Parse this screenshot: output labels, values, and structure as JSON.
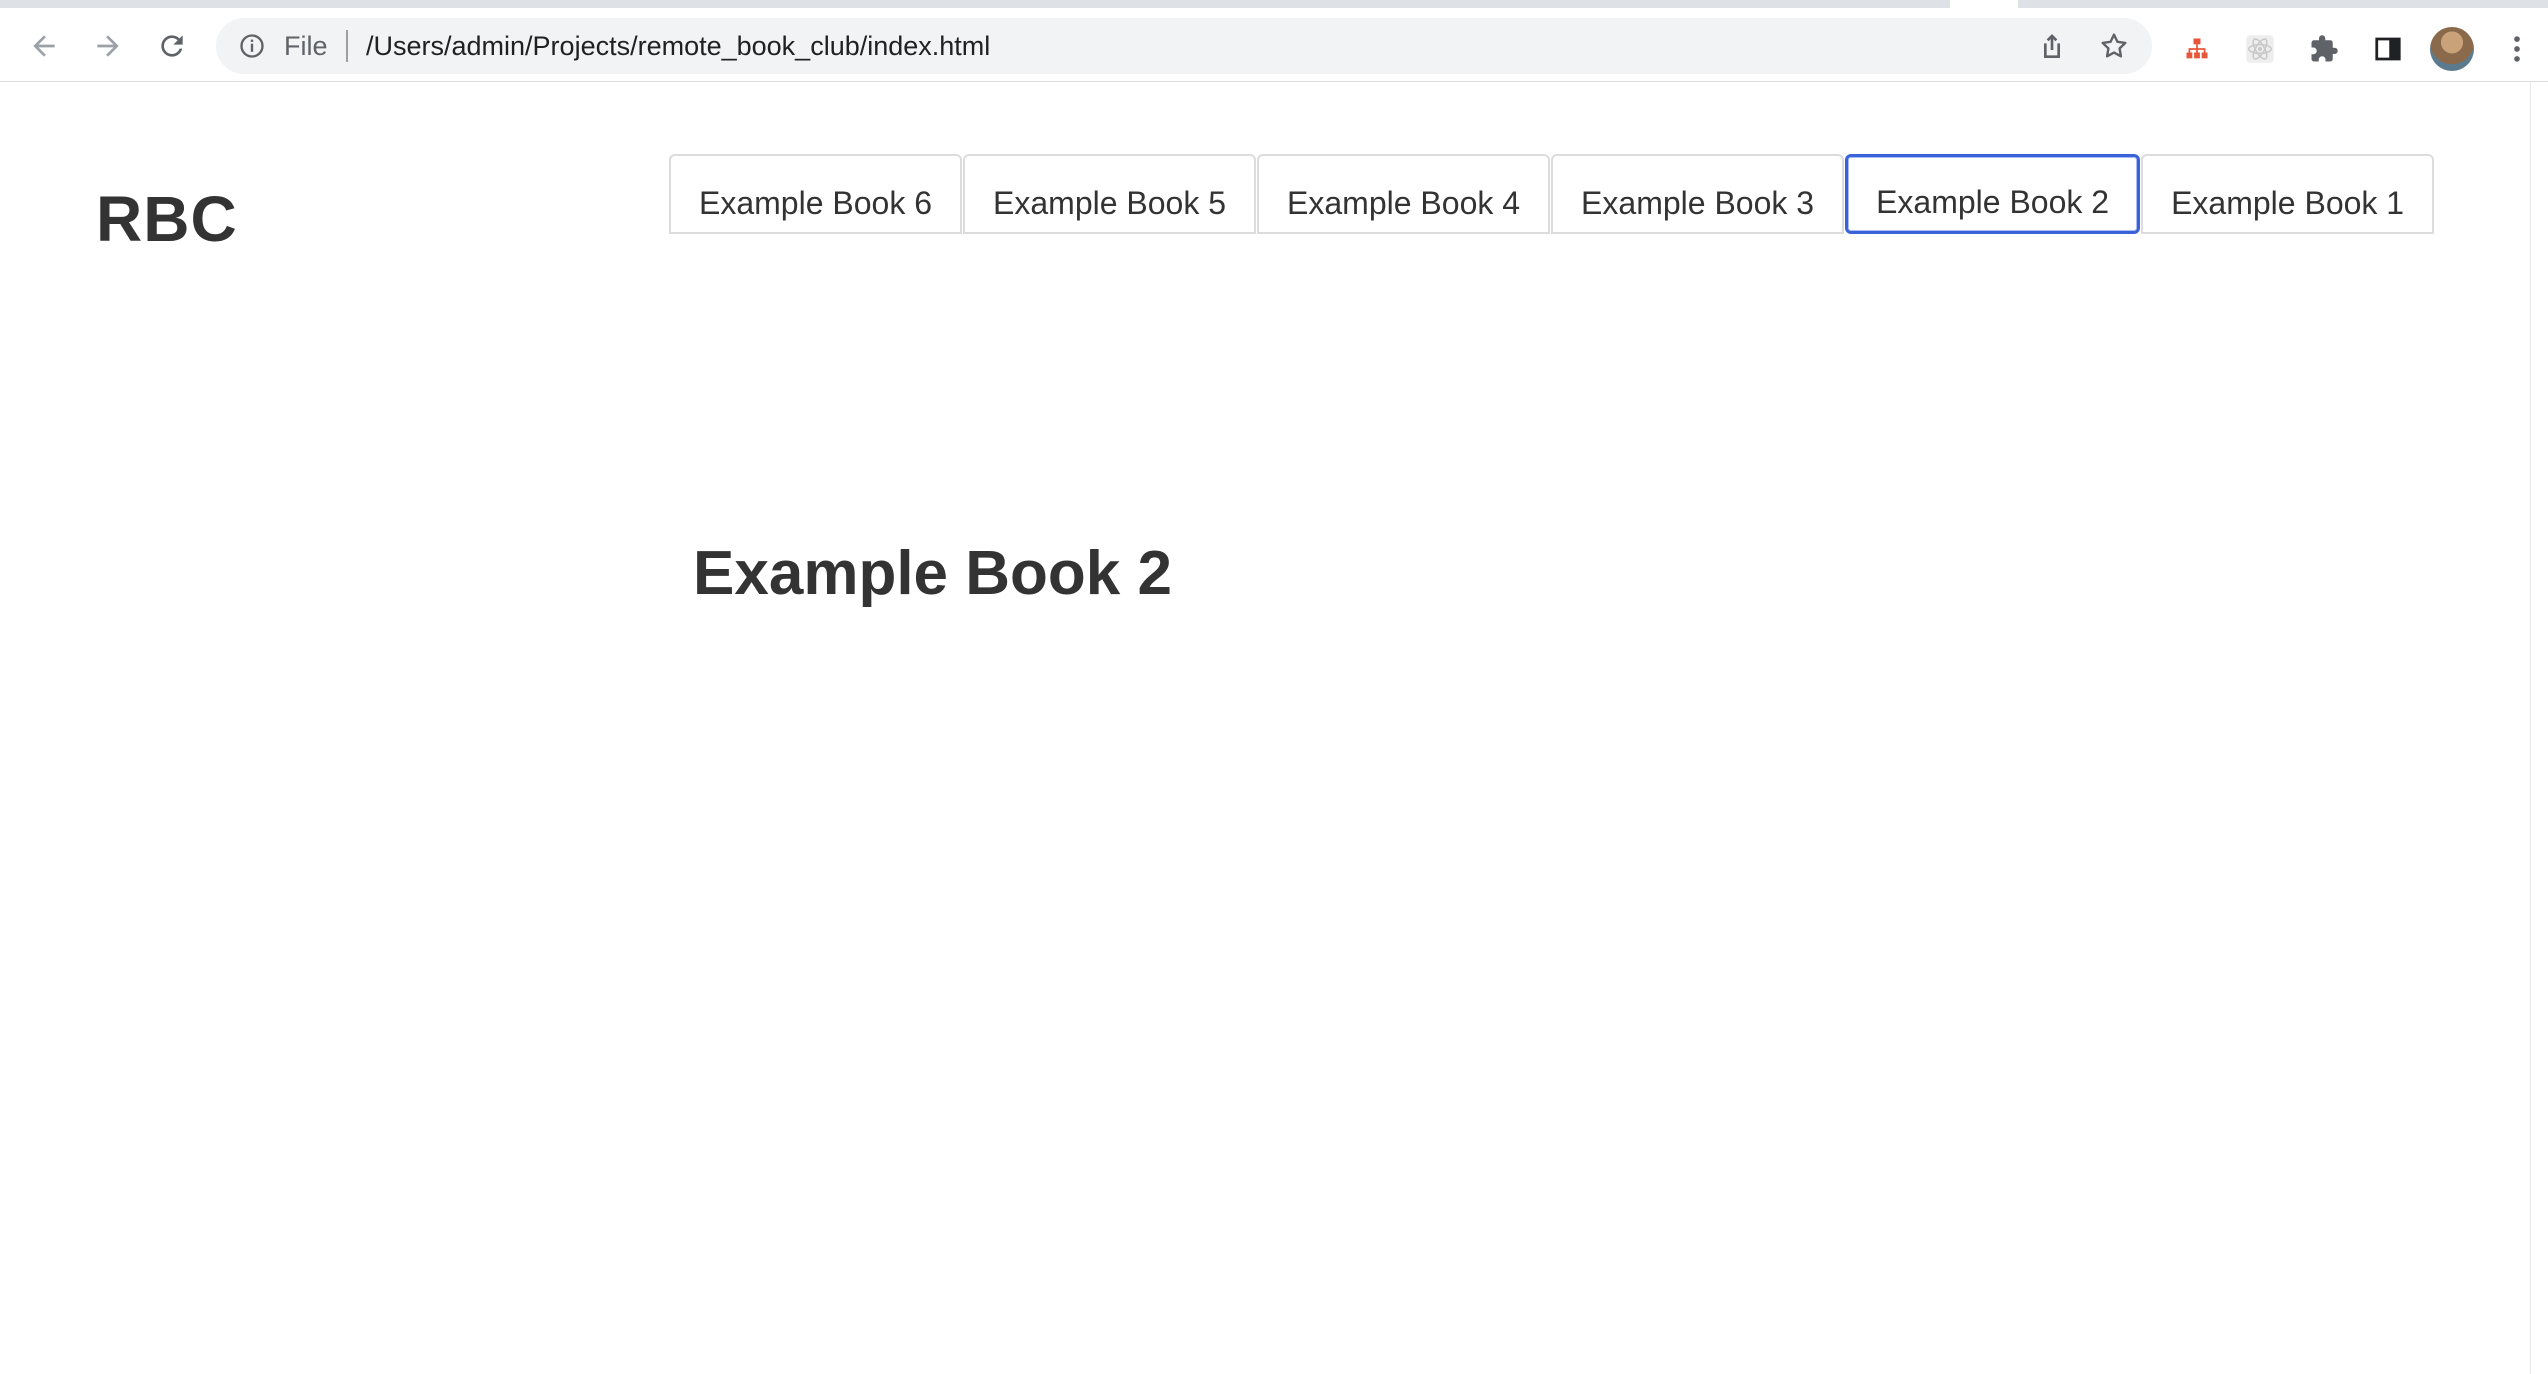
{
  "browser": {
    "scheme_label": "File",
    "url": "/Users/admin/Projects/remote_book_club/index.html"
  },
  "page": {
    "brand": "RBC",
    "tabs": [
      {
        "label": "Example Book 6"
      },
      {
        "label": "Example Book 5"
      },
      {
        "label": "Example Book 4"
      },
      {
        "label": "Example Book 3"
      },
      {
        "label": "Example Book 2",
        "active": true
      },
      {
        "label": "Example Book 1"
      }
    ],
    "current_title": "Example Book 2"
  },
  "icons": {
    "back": "arrow-left-icon",
    "forward": "arrow-right-icon",
    "reload": "reload-icon",
    "info": "info-icon",
    "share": "share-icon",
    "bookmark": "star-icon",
    "extensions": [
      "sitemap-extension-icon",
      "react-devtools-icon",
      "puzzle-icon",
      "side-panel-icon"
    ],
    "menu": "kebab-menu-icon"
  },
  "colors": {
    "active_tab_border": "#3b63d9",
    "text": "#333333",
    "omnibox_bg": "#f1f3f4"
  }
}
